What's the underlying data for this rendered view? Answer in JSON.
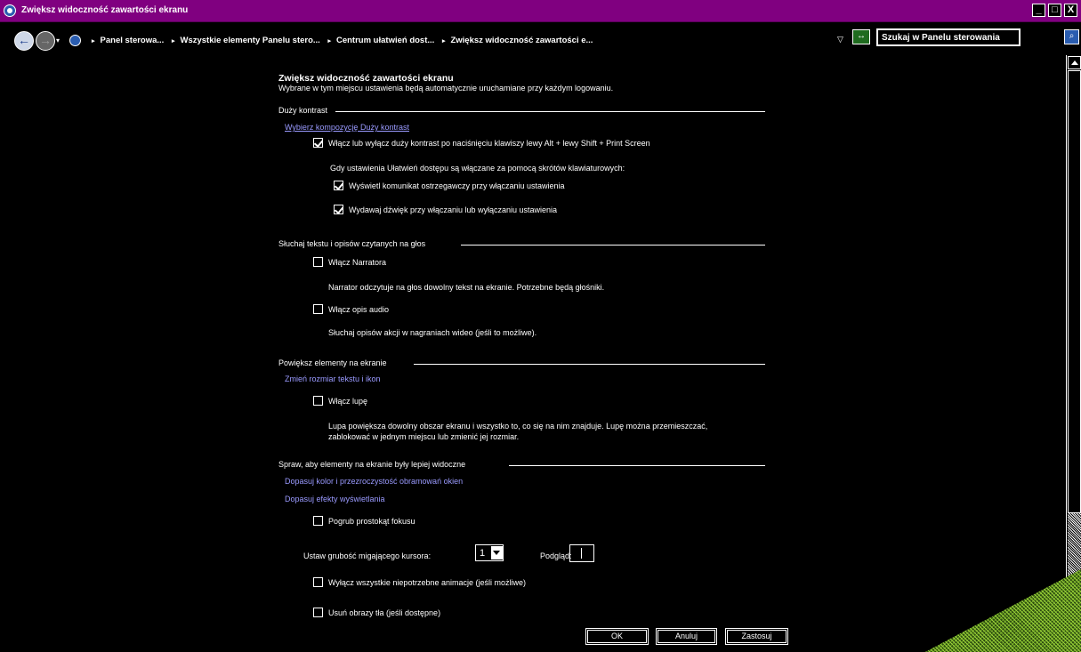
{
  "window": {
    "title": "Zwiększ widoczność zawartości ekranu",
    "controls": [
      "_",
      "□",
      "X"
    ]
  },
  "address_bar": {
    "crumbs": [
      "Panel sterowa...",
      "Wszystkie elementy Panelu stero...",
      "Centrum ułatwień dost...",
      "Zwiększ widoczność zawartości e..."
    ],
    "search_placeholder": "Szukaj w Panelu sterowania",
    "back_icon": "←",
    "forward_icon": "→",
    "refresh_icon": "↔",
    "search_icon": "⌕",
    "dropdown_icon": "▽"
  },
  "page": {
    "title": "Zwiększ widoczność zawartości ekranu",
    "subtitle": "Wybrane w tym miejscu ustawienia będą automatycznie uruchamiane przy każdym logowaniu."
  },
  "sections": {
    "high_contrast": {
      "title": "Duży kontrast",
      "link": "Wybierz kompozycję Duży kontrast",
      "toggle_label": "Włącz lub wyłącz duży kontrast po naciśnięciu klawiszy lewy Alt + lewy Shift + Print Screen",
      "toggle_checked": true,
      "shortcut_note": "Gdy ustawienia Ułatwień dostępu są włączane za pomocą skrótów klawiaturowych:",
      "warn_label": "Wyświetl komunikat ostrzegawczy przy włączaniu ustawienia",
      "warn_checked": true,
      "sound_label": "Wydawaj dźwięk przy włączaniu lub wyłączaniu ustawienia",
      "sound_checked": true
    },
    "narrator": {
      "title": "Słuchaj tekstu i opisów czytanych na głos",
      "narrator_label": "Włącz Narratora",
      "narrator_checked": false,
      "narrator_desc": "Narrator odczytuje na głos dowolny tekst na ekranie. Potrzebne będą głośniki.",
      "audio_label": "Włącz opis audio",
      "audio_checked": false,
      "audio_desc": "Słuchaj opisów akcji w nagraniach wideo (jeśli to możliwe)."
    },
    "magnify": {
      "title": "Powiększ elementy na ekranie",
      "link": "Zmień rozmiar tekstu i ikon",
      "magnifier_label": "Włącz lupę",
      "magnifier_checked": false,
      "desc_line1": "Lupa powiększa dowolny obszar ekranu i wszystko to, co się na nim znajduje. Lupę można przemieszczać,",
      "desc_line2": "zablokować w jednym miejscu lub zmienić jej rozmiar."
    },
    "visibility": {
      "title": "Spraw, aby elementy na ekranie były lepiej widoczne",
      "link1": "Dopasuj kolor i przezroczystość obramowań okien",
      "link2": "Dopasuj efekty wyświetlania",
      "focus_label": "Pogrub prostokąt fokusu",
      "focus_checked": false,
      "cursor_label": "Ustaw grubość migającego kursora:",
      "cursor_value": "1",
      "preview_label": "Podgląd:",
      "anim_label": "Wyłącz wszystkie niepotrzebne animacje (jeśli możliwe)",
      "anim_checked": false,
      "bg_label": "Usuń obrazy tła (jeśli dostępne)",
      "bg_checked": false
    }
  },
  "buttons": {
    "ok": "OK",
    "cancel": "Anuluj",
    "apply": "Zastosuj"
  }
}
